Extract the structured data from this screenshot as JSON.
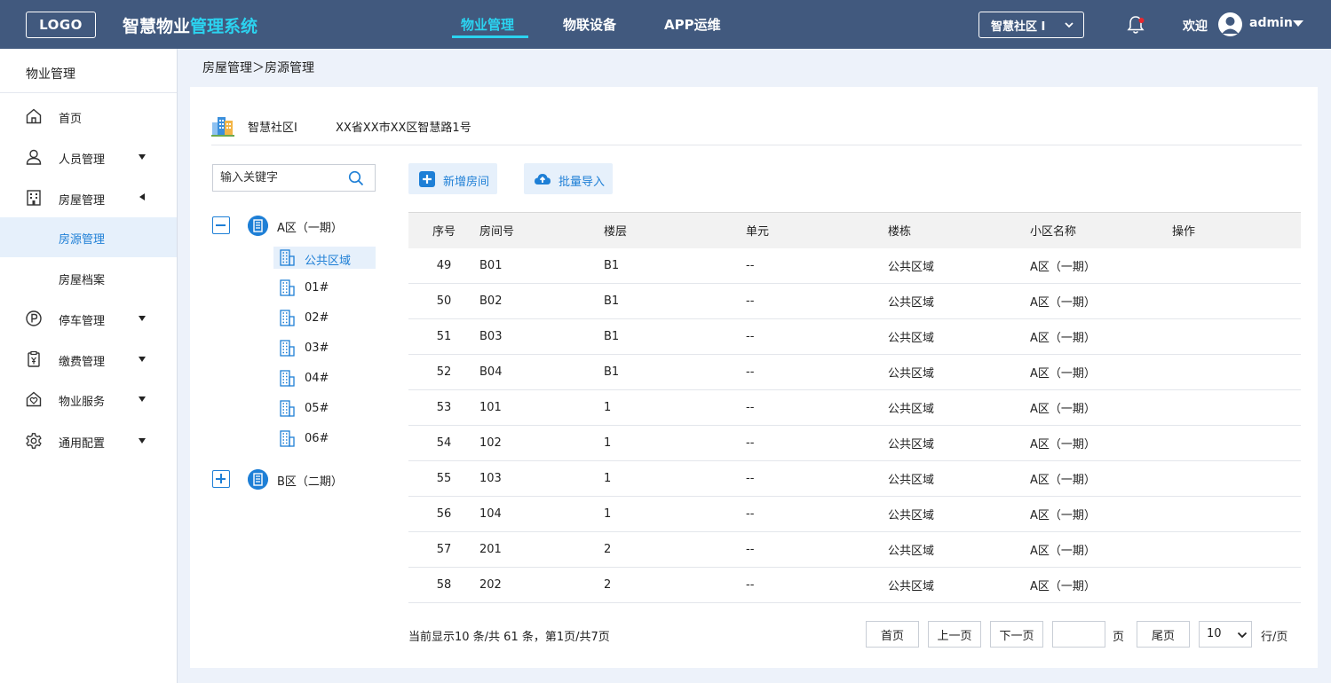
{
  "header": {
    "logo": "LOGO",
    "brand_part1": "智慧物业",
    "brand_part2": "管理系统",
    "nav": [
      {
        "label": "物业管理",
        "active": true
      },
      {
        "label": "物联设备",
        "active": false
      },
      {
        "label": "APP运维",
        "active": false
      }
    ],
    "community_selected": "智慧社区 I",
    "welcome": "欢迎",
    "username": "admin",
    "notification_dot": true
  },
  "sidebar": {
    "title": "物业管理",
    "items": [
      {
        "label": "首页",
        "icon": "home-icon",
        "caret": "none"
      },
      {
        "label": "人员管理",
        "icon": "user-icon",
        "caret": "down"
      },
      {
        "label": "房屋管理",
        "icon": "building-icon",
        "caret": "left"
      },
      {
        "label": "房源管理",
        "icon": "",
        "caret": "none",
        "active": true
      },
      {
        "label": "房屋档案",
        "icon": "",
        "caret": "none"
      },
      {
        "label": "停车管理",
        "icon": "parking-icon",
        "caret": "down"
      },
      {
        "label": "缴费管理",
        "icon": "payment-icon",
        "caret": "down"
      },
      {
        "label": "物业服务",
        "icon": "service-icon",
        "caret": "down"
      },
      {
        "label": "通用配置",
        "icon": "gear-icon",
        "caret": "down"
      }
    ]
  },
  "breadcrumb": "房屋管理＞房源管理",
  "community": {
    "name": "智慧社区I",
    "address": "XX省XX市XX区智慧路1号"
  },
  "search": {
    "placeholder": "输入关键字"
  },
  "tree": {
    "zones": [
      {
        "label": "A区（一期）",
        "expanded": true,
        "children": [
          "公共区域",
          "01#",
          "02#",
          "03#",
          "04#",
          "05#",
          "06#"
        ],
        "selected": "公共区域"
      },
      {
        "label": "B区（二期）",
        "expanded": false,
        "children": []
      }
    ]
  },
  "toolbar": {
    "add_label": "新增房间",
    "import_label": "批量导入"
  },
  "table": {
    "columns": [
      "序号",
      "房间号",
      "楼层",
      "单元",
      "楼栋",
      "小区名称",
      "操作"
    ],
    "rows": [
      [
        "49",
        "B01",
        "B1",
        "--",
        "公共区域",
        "A区（一期）",
        ""
      ],
      [
        "50",
        "B02",
        "B1",
        "--",
        "公共区域",
        "A区（一期）",
        ""
      ],
      [
        "51",
        "B03",
        "B1",
        "--",
        "公共区域",
        "A区（一期）",
        ""
      ],
      [
        "52",
        "B04",
        "B1",
        "--",
        "公共区域",
        "A区（一期）",
        ""
      ],
      [
        "53",
        "101",
        "1",
        "--",
        "公共区域",
        "A区（一期）",
        ""
      ],
      [
        "54",
        "102",
        "1",
        "--",
        "公共区域",
        "A区（一期）",
        ""
      ],
      [
        "55",
        "103",
        "1",
        "--",
        "公共区域",
        "A区（一期）",
        ""
      ],
      [
        "56",
        "104",
        "1",
        "--",
        "公共区域",
        "A区（一期）",
        ""
      ],
      [
        "57",
        "201",
        "2",
        "--",
        "公共区域",
        "A区（一期）",
        ""
      ],
      [
        "58",
        "202",
        "2",
        "--",
        "公共区域",
        "A区（一期）",
        ""
      ]
    ]
  },
  "pagination": {
    "info": "当前显示10 条/共 61 条，第1页/共7页",
    "first": "首页",
    "prev": "上一页",
    "next": "下一页",
    "page_input": "",
    "page_unit": "页",
    "last": "尾页",
    "page_size": "10",
    "rows_unit": "行/页"
  },
  "colors": {
    "header_bg": "#41597e",
    "accent_cyan": "#2bd3f0",
    "primary_blue": "#1e7fd6",
    "active_bg": "#e6f0fb"
  }
}
